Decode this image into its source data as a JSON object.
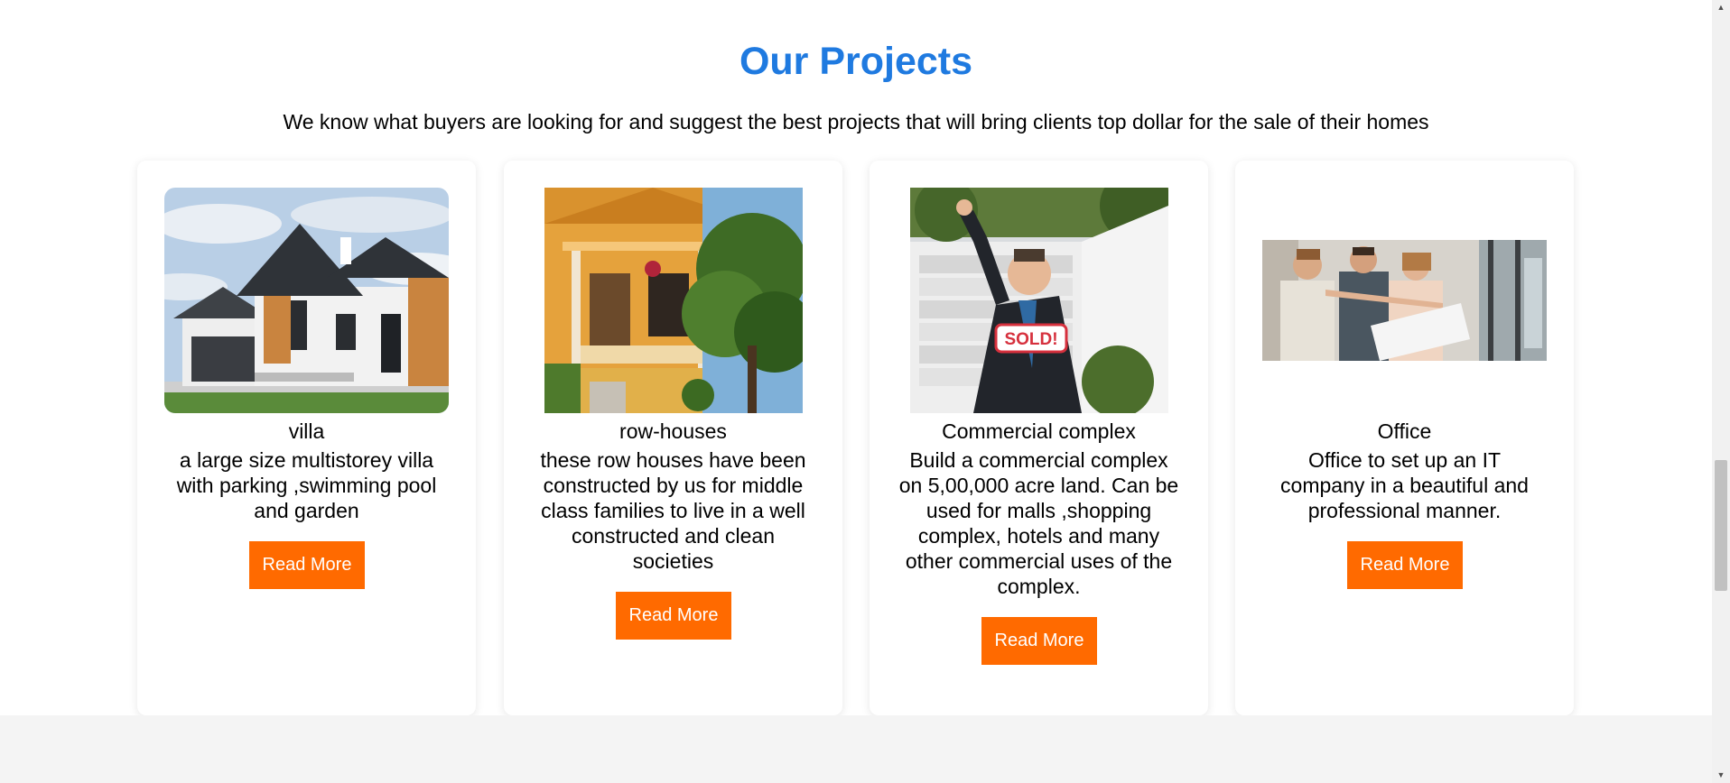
{
  "section": {
    "title": "Our Projects",
    "subtitle": "We know what buyers are looking for and suggest the best projects that will bring clients top dollar for the sale of their homes"
  },
  "colors": {
    "title": "#1f7ae0",
    "button": "#ff6a00",
    "footer_band": "#f4f4f4"
  },
  "projects": [
    {
      "title": "villa",
      "description": "a large size multistorey villa with parking ,swimming pool and garden",
      "button_label": "Read More",
      "image_icon": "villa-photo"
    },
    {
      "title": "row-houses",
      "description": "these row houses have been constructed by us for middle class families to live in a well constructed and clean societies",
      "button_label": "Read More",
      "image_icon": "row-houses-photo"
    },
    {
      "title": "Commercial complex",
      "description": "Build a commercial complex on 5,00,000 acre land. Can be used for malls ,shopping complex, hotels and many other commercial uses of the complex.",
      "button_label": "Read More",
      "image_icon": "commercial-complex-photo",
      "sign_text": "SOLD!"
    },
    {
      "title": "Office",
      "description": "Office to set up an IT company in a beautiful and professional manner.",
      "button_label": "Read More",
      "image_icon": "office-photo"
    }
  ]
}
